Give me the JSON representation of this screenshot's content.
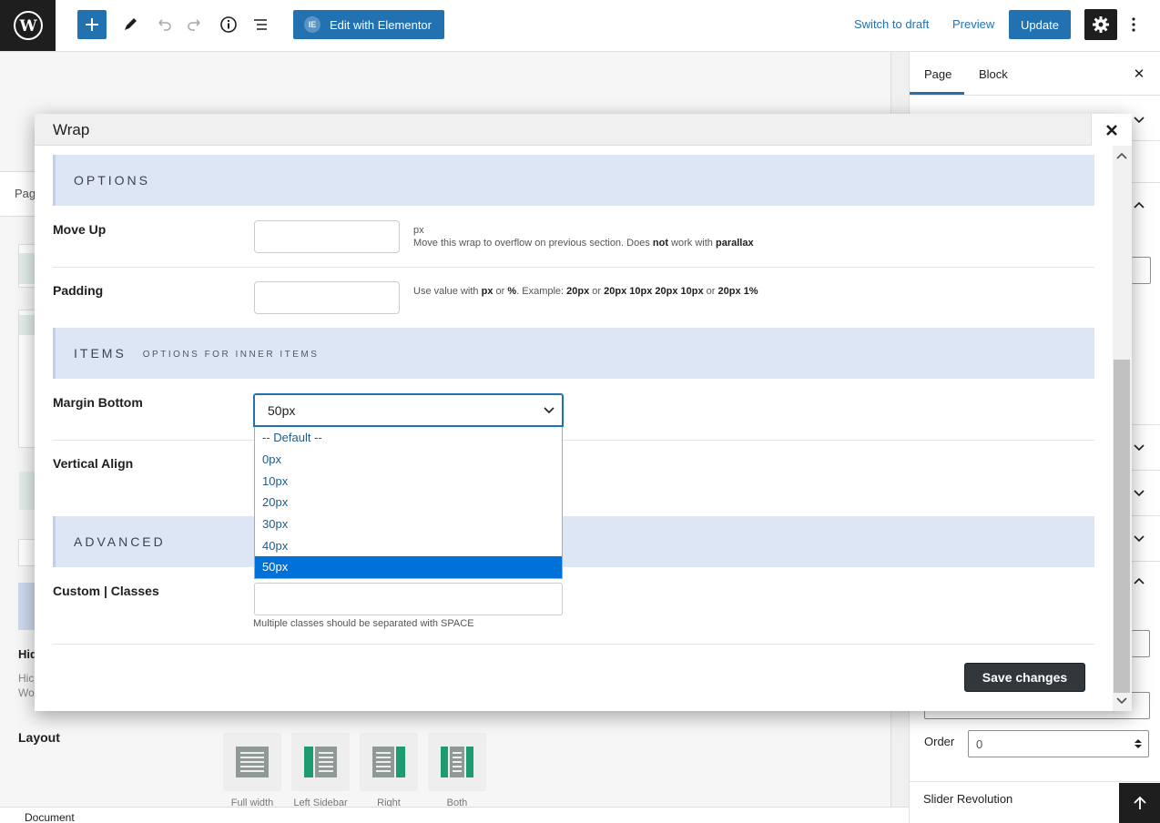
{
  "toolbar": {
    "elementor_label": "Edit with Elementor",
    "switch_draft_label": "Switch to draft",
    "preview_label": "Preview",
    "update_label": "Update"
  },
  "background": {
    "page_tab_label": "Pag",
    "hide_label": "Hid",
    "hide_desc_1": "Hic",
    "hide_desc_2": "Wo",
    "layout_label": "Layout",
    "layout_options": [
      "Full width",
      "Left Sidebar",
      "Right",
      "Both"
    ],
    "document_label": "Document"
  },
  "sidebar": {
    "tabs": [
      "Page",
      "Block"
    ],
    "order_label": "Order",
    "order_value": "0",
    "slider_revolution_label": "Slider Revolution"
  },
  "modal": {
    "title": "Wrap",
    "sections": {
      "options": "OPTIONS",
      "items": "ITEMS",
      "items_sub": "OPTIONS FOR INNER ITEMS",
      "advanced": "ADVANCED"
    },
    "move_up": {
      "label": "Move Up",
      "unit": "px",
      "hint_pre": "Move this wrap to overflow on previous section. Does ",
      "hint_not": "not",
      "hint_mid": " work with ",
      "hint_parallax": "parallax"
    },
    "padding": {
      "label": "Padding",
      "hint_1": "Use value with ",
      "hint_px": "px",
      "hint_or1": " or ",
      "hint_pct": "%",
      "hint_ex": ". Example: ",
      "ex1": "20px",
      "or2": " or ",
      "ex2": "20px 10px 20px 10px",
      "or3": " or ",
      "ex3": "20px 1%"
    },
    "margin_bottom": {
      "label": "Margin Bottom",
      "selected": "50px",
      "options": [
        "-- Default --",
        "0px",
        "10px",
        "20px",
        "30px",
        "40px",
        "50px"
      ]
    },
    "vertical_align_label": "Vertical Align",
    "custom_classes": {
      "label": "Custom | Classes",
      "hint": "Multiple classes should be separated with SPACE"
    },
    "save_label": "Save changes"
  },
  "colors": {
    "wp_blue": "#2271b1",
    "section_bg": "#dde6f5",
    "selected_option": "#0071d9",
    "save_button": "#32373c"
  }
}
